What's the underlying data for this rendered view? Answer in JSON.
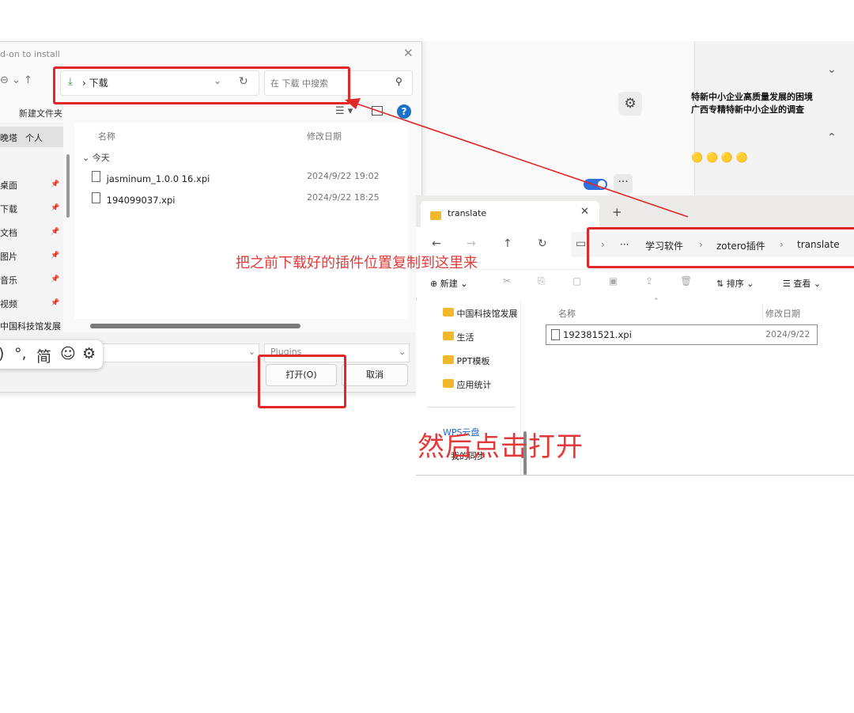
{
  "bg_app": {
    "side_text_lines": [
      "特新中小企业高质量发展的困境",
      "广西专精特新中小企业的调查"
    ],
    "side_dots": "🟡🟡🟡🟡",
    "gear_icon": "⚙",
    "more_label": "···",
    "chevron_down": "⌄",
    "chevron_up": "⌃"
  },
  "dialog": {
    "title": "d-on to install",
    "close_glyph": "✕",
    "nav_glyphs": "⊖  ⌄   ↑",
    "address": {
      "download_icon": "⤓",
      "path": "›  下载",
      "chevron": "⌄",
      "refresh": "↻"
    },
    "search": {
      "placeholder": "在 下载 中搜索",
      "icon": "⚲"
    },
    "new_folder": "新建文件夹",
    "view_glyph": "☰ ▾",
    "help_glyph": "?",
    "nav_tabs": [
      "晚塔",
      "个人"
    ],
    "nav_items": [
      "桌面",
      "下载",
      "文档",
      "图片",
      "音乐",
      "视频",
      "中国科技馆发展"
    ],
    "columns": {
      "name": "名称",
      "date": "修改日期"
    },
    "group": "今天",
    "files": [
      {
        "name": "jasminum_1.0.0 16.xpi",
        "date": "2024/9/22 19:02"
      },
      {
        "name": "194099037.xpi",
        "date": "2024/9/22 18:25"
      }
    ],
    "file_type": "Plugins",
    "open_button": "打开(O)",
    "cancel_button": "取消",
    "ime_glyphs": [
      ")",
      "°,",
      "简",
      "☺",
      "⚙"
    ]
  },
  "explorer": {
    "tab_title": "translate",
    "tab_close": "✕",
    "new_tab": "+",
    "nav_glyphs": {
      "back": "←",
      "forward": "→",
      "up": "↑",
      "refresh": "↻",
      "pc": "▭"
    },
    "breadcrumb": [
      "学习软件",
      "zotero插件",
      "translate"
    ],
    "breadcrumb_more": "···",
    "commands": {
      "new": "新建",
      "sort": "排序",
      "view": "查看"
    },
    "cmd_icons": [
      "✂",
      "⎘",
      "▢",
      "▣",
      "⇪",
      "🗑"
    ],
    "nav_items": [
      "中国科技馆发展",
      "生活",
      "PPT模板",
      "应用统计"
    ],
    "cloud_item": "WPS云盘",
    "cloud_sub": "我的同步",
    "columns": {
      "name": "名称",
      "date": "修改日期"
    },
    "files": [
      {
        "name": "192381521.xpi",
        "date": "2024/9/22"
      }
    ]
  },
  "annotations": {
    "copy_instruction": "把之前下载好的插件位置复制到这里来",
    "open_instruction": "然后点击打开"
  },
  "colors": {
    "annotation_red": "#e02828",
    "accent_blue": "#2f6fde",
    "folder_yellow": "#f0b82a"
  }
}
